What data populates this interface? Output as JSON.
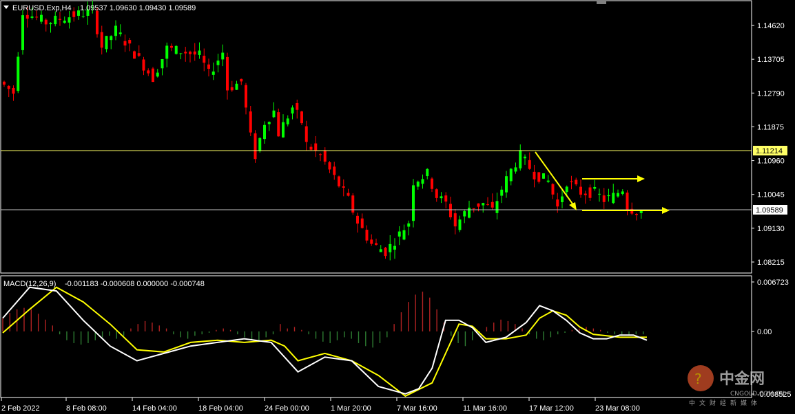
{
  "header": {
    "symbol_label": "EURUSD.Exp,H4",
    "ohlc": "1.09537 1.09630 1.09430 1.09589"
  },
  "macd_header": {
    "label": "MACD(12,26,9)",
    "values": "-0.001183 -0.000608 0.000000 -0.000748"
  },
  "price_axis": {
    "ticks": [
      "1.14620",
      "1.13705",
      "1.12790",
      "1.11875",
      "1.10960",
      "1.10045",
      "1.09130",
      "1.08215"
    ],
    "hline_label": "1.11214",
    "current_label": "1.09589"
  },
  "macd_axis": {
    "ticks": [
      "0.006723",
      "0.00",
      "-0.008525"
    ]
  },
  "time_axis": {
    "ticks": [
      "2 Feb 2022",
      "8 Feb 08:00",
      "14 Feb 04:00",
      "18 Feb 04:00",
      "24 Feb 00:00",
      "1 Mar 20:00",
      "7 Mar 16:00",
      "11 Mar 16:00",
      "17 Mar 12:00",
      "23 Mar 08:00"
    ]
  },
  "colors": {
    "bull": "#00ff00",
    "bear": "#ff0000",
    "hline": "#ffff66",
    "current": "#c0c0c0",
    "arrow": "#ffff00",
    "macd_hist_pos": "#b22222",
    "macd_hist_neg": "#2e7d32",
    "macd_line": "#ffffff",
    "signal_line": "#ffff00",
    "axis": "#ffffff"
  },
  "watermark": {
    "brand_cn": "中金网",
    "brand_en": "CNGOLD.COM.CN",
    "tagline": "中文财经新媒体"
  },
  "chart_data": [
    {
      "type": "candlestick",
      "title": "EURUSD.Exp,H4",
      "ylim": [
        1.0775,
        1.1515
      ],
      "path": [
        [
          0,
          1.131
        ],
        [
          3,
          1.128
        ],
        [
          5,
          1.15
        ],
        [
          10,
          1.147
        ],
        [
          16,
          1.149
        ],
        [
          20,
          1.15
        ],
        [
          22,
          1.1405
        ],
        [
          25,
          1.145
        ],
        [
          30,
          1.137
        ],
        [
          33,
          1.132
        ],
        [
          36,
          1.14
        ],
        [
          40,
          1.139
        ],
        [
          43,
          1.138
        ],
        [
          45,
          1.133
        ],
        [
          48,
          1.139
        ],
        [
          49,
          1.129
        ],
        [
          52,
          1.131
        ],
        [
          54,
          1.116
        ],
        [
          55,
          1.111
        ],
        [
          57,
          1.12
        ],
        [
          59,
          1.123
        ],
        [
          60,
          1.117
        ],
        [
          63,
          1.124
        ],
        [
          65,
          1.12
        ],
        [
          66,
          1.114
        ],
        [
          69,
          1.111
        ],
        [
          72,
          1.105
        ],
        [
          75,
          1.099
        ],
        [
          77,
          1.093
        ],
        [
          80,
          1.087
        ],
        [
          83,
          1.085
        ],
        [
          85,
          1.088
        ],
        [
          88,
          1.093
        ],
        [
          89,
          1.104
        ],
        [
          92,
          1.106
        ],
        [
          94,
          1.1
        ],
        [
          96,
          1.098
        ],
        [
          98,
          1.092
        ],
        [
          101,
          1.097
        ],
        [
          104,
          1.098
        ],
        [
          106,
          1.096
        ],
        [
          108,
          1.102
        ],
        [
          110,
          1.107
        ],
        [
          112,
          1.111
        ],
        [
          115,
          1.106
        ],
        [
          118,
          1.104
        ],
        [
          120,
          1.097
        ],
        [
          122,
          1.104
        ],
        [
          125,
          1.101
        ],
        [
          128,
          1.101
        ],
        [
          130,
          1.099
        ],
        [
          132,
          1.1
        ],
        [
          134,
          1.102
        ],
        [
          135,
          1.097
        ],
        [
          137,
          1.0959
        ]
      ],
      "bars": 138
    },
    {
      "type": "macd",
      "name": "MACD(12,26,9)",
      "ylim": [
        -0.009,
        0.0072
      ],
      "macd_line": [
        [
          0,
          0.0018
        ],
        [
          4,
          0.006
        ],
        [
          8,
          0.0055
        ],
        [
          12,
          0.0015
        ],
        [
          16,
          -0.002
        ],
        [
          20,
          -0.004
        ],
        [
          24,
          -0.003
        ],
        [
          28,
          -0.002
        ],
        [
          32,
          -0.0015
        ],
        [
          36,
          -0.001
        ],
        [
          40,
          -0.0015
        ],
        [
          42,
          -0.0035
        ],
        [
          44,
          -0.0055
        ],
        [
          48,
          -0.0035
        ],
        [
          52,
          -0.004
        ],
        [
          56,
          -0.0075
        ],
        [
          60,
          -0.0085
        ],
        [
          62,
          -0.0078
        ],
        [
          64,
          -0.005
        ],
        [
          66,
          0.0015
        ],
        [
          68,
          0.0015
        ],
        [
          70,
          0.0005
        ],
        [
          72,
          -0.0015
        ],
        [
          75,
          -0.0008
        ],
        [
          78,
          0.0012
        ],
        [
          80,
          0.0035
        ],
        [
          82,
          0.0028
        ],
        [
          84,
          0.0015
        ],
        [
          86,
          -0.0002
        ],
        [
          88,
          -0.001
        ],
        [
          90,
          -0.001
        ],
        [
          92,
          -0.0005
        ],
        [
          94,
          -0.0005
        ],
        [
          96,
          -0.0012
        ]
      ],
      "signal_line": [
        [
          0,
          -0.0002
        ],
        [
          4,
          0.003
        ],
        [
          8,
          0.006
        ],
        [
          12,
          0.004
        ],
        [
          16,
          0.001
        ],
        [
          20,
          -0.0025
        ],
        [
          24,
          -0.0028
        ],
        [
          28,
          -0.0015
        ],
        [
          32,
          -0.0012
        ],
        [
          36,
          -0.0015
        ],
        [
          40,
          -0.0012
        ],
        [
          42,
          -0.002
        ],
        [
          44,
          -0.004
        ],
        [
          48,
          -0.003
        ],
        [
          52,
          -0.004
        ],
        [
          56,
          -0.006
        ],
        [
          60,
          -0.0088
        ],
        [
          64,
          -0.007
        ],
        [
          66,
          -0.003
        ],
        [
          68,
          0.001
        ],
        [
          70,
          0.0007
        ],
        [
          72,
          -0.001
        ],
        [
          75,
          -0.001
        ],
        [
          78,
          -0.0005
        ],
        [
          80,
          0.0018
        ],
        [
          82,
          0.0028
        ],
        [
          84,
          0.0022
        ],
        [
          86,
          0.0006
        ],
        [
          88,
          -0.0004
        ],
        [
          90,
          -0.0006
        ],
        [
          92,
          -0.0008
        ],
        [
          94,
          -0.0008
        ],
        [
          96,
          -0.0008
        ]
      ],
      "histogram": [
        0.0018,
        0.0025,
        0.003,
        0.0032,
        0.003,
        0.0024,
        0.0016,
        0.0008,
        -0.0004,
        -0.0012,
        -0.0016,
        -0.0018,
        -0.0016,
        -0.0012,
        -0.0008,
        -0.0006,
        -0.001,
        -0.0006,
        0.0004,
        0.001,
        0.0014,
        0.0012,
        0.0008,
        0.0004,
        -0.0004,
        -0.0008,
        -0.001,
        -0.0006,
        -0.0004,
        -0.0002,
        0.0002,
        0.0004,
        0.0002,
        -0.0004,
        -0.0008,
        -0.0012,
        -0.0012,
        -0.0008,
        -0.0004,
        0.001,
        0.0004,
        0.0006,
        0.0002,
        -0.0004,
        -0.001,
        -0.0014,
        -0.0016,
        -0.0012,
        -0.0008,
        -0.001,
        -0.0016,
        -0.002,
        -0.0022,
        -0.0016,
        -0.0008,
        0.001,
        0.0026,
        0.004,
        0.005,
        0.0054,
        0.0046,
        0.003,
        0.0012,
        -0.0006,
        -0.0016,
        -0.002,
        -0.0012,
        -0.0002,
        0.0006,
        0.0012,
        0.0016,
        0.0014,
        0.001,
        0.0004,
        -0.0004,
        -0.001,
        -0.0012,
        -0.0008,
        -0.0004,
        -0.0002,
        0.0002,
        0.0004,
        0.0006,
        0.0004,
        0.0002,
        -0.0002,
        -0.0004,
        -0.0006,
        -0.0006,
        -0.0004,
        -0.0004
      ]
    }
  ]
}
